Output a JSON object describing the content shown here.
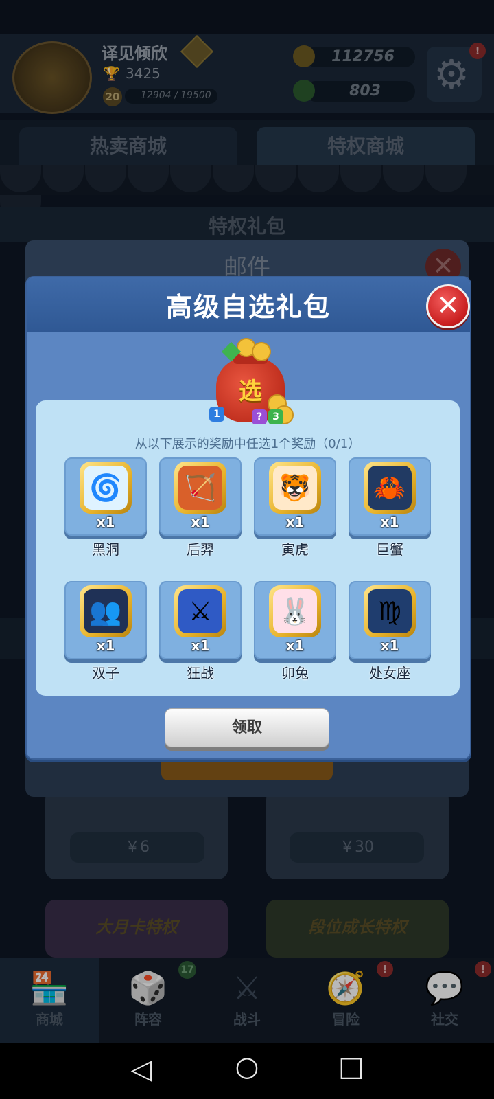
{
  "player": {
    "name": "译见倾欣",
    "trophies": "3425",
    "level": "20",
    "xp": "12904 / 19500"
  },
  "currency": {
    "gold": "112756",
    "gems": "803"
  },
  "badges": {
    "settings": "!",
    "lineup": "17",
    "adventure": "!",
    "social": "!"
  },
  "shop_tabs": [
    {
      "label": "热卖商城"
    },
    {
      "label": "特权商城"
    }
  ],
  "section_title": "特权礼包",
  "cards": [
    {
      "price": "￥6"
    },
    {
      "price": "￥30"
    },
    {
      "title": "大月卡特权"
    },
    {
      "title": "段位成长特权"
    }
  ],
  "mail": {
    "title": "邮件",
    "close": "✕"
  },
  "dialog": {
    "title": "高级自选礼包",
    "close": "✕",
    "bag_char": "选",
    "hint": "从以下展示的奖励中任选1个奖励（0/1）",
    "claim_label": "领取",
    "rewards": [
      {
        "name": "黑洞",
        "qty": "x1",
        "icon": "black-hole-icon",
        "glyph": "🌀",
        "bg": "#dff3ff"
      },
      {
        "name": "后羿",
        "qty": "x1",
        "icon": "archer-icon",
        "glyph": "🏹",
        "bg": "#d9602a"
      },
      {
        "name": "寅虎",
        "qty": "x1",
        "icon": "tiger-icon",
        "glyph": "🐯",
        "bg": "#ffe9c9"
      },
      {
        "name": "巨蟹",
        "qty": "x1",
        "icon": "crab-icon",
        "glyph": "🦀",
        "bg": "#213a63"
      },
      {
        "name": "双子",
        "qty": "x1",
        "icon": "gemini-icon",
        "glyph": "👥",
        "bg": "#1f3156"
      },
      {
        "name": "狂战",
        "qty": "x1",
        "icon": "berserker-icon",
        "glyph": "⚔",
        "bg": "#2f5ac5"
      },
      {
        "name": "卯兔",
        "qty": "x1",
        "icon": "rabbit-icon",
        "glyph": "🐰",
        "bg": "#ffdfe8"
      },
      {
        "name": "处女座",
        "qty": "x1",
        "icon": "virgo-icon",
        "glyph": "♍",
        "bg": "#1f3d6e"
      }
    ]
  },
  "nav": [
    {
      "label": "商城",
      "icon": "store-icon",
      "glyph": "🏪"
    },
    {
      "label": "阵容",
      "icon": "dice-icon",
      "glyph": "🎲"
    },
    {
      "label": "战斗",
      "icon": "swords-icon",
      "glyph": "⚔"
    },
    {
      "label": "冒险",
      "icon": "compass-icon",
      "glyph": "🧭"
    },
    {
      "label": "社交",
      "icon": "chat-icon",
      "glyph": "💬"
    }
  ],
  "system_nav": {
    "back": "◁",
    "home": "○",
    "recents": "□"
  }
}
